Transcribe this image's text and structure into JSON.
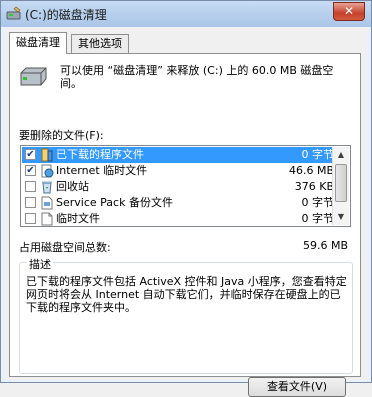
{
  "window": {
    "title": "(C:)的磁盘清理",
    "close_symbol": "✕"
  },
  "tabs": [
    {
      "label": "磁盘清理",
      "active": true
    },
    {
      "label": "其他选项",
      "active": false
    }
  ],
  "intro_text": "可以使用 “磁盘清理” 来释放 (C:) 上的 60.0 MB 磁盘空间。",
  "files_label": "要删除的文件(F):",
  "files": [
    {
      "name": "已下载的程序文件",
      "size": "0 字节",
      "checked": true,
      "selected": true,
      "icon": "downloaded-program-files-icon"
    },
    {
      "name": "Internet 临时文件",
      "size": "46.6 MB",
      "checked": true,
      "selected": false,
      "icon": "internet-temp-files-icon"
    },
    {
      "name": "回收站",
      "size": "376 KB",
      "checked": false,
      "selected": false,
      "icon": "recycle-bin-icon"
    },
    {
      "name": "Service Pack 备份文件",
      "size": "0 字节",
      "checked": false,
      "selected": false,
      "icon": "service-pack-icon"
    },
    {
      "name": "临时文件",
      "size": "0 字节",
      "checked": false,
      "selected": false,
      "icon": "temp-files-icon"
    }
  ],
  "total": {
    "label": "占用磁盘空间总数:",
    "value": "59.6 MB"
  },
  "description": {
    "title": "描述",
    "text": "已下载的程序文件包括 ActiveX 控件和 Java 小程序，您查看特定网页时将会从 Internet 自动下载它们，并临时保存在硬盘上的已下载的程序文件夹中。"
  },
  "view_files_button": "查看文件(V)",
  "colors": {
    "selection": "#3399ff",
    "title_gradient": "#c7dbf3",
    "close_button": "#c6412c"
  }
}
